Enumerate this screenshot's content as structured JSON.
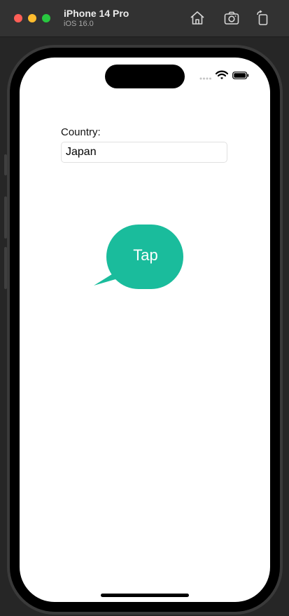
{
  "window": {
    "device_name": "iPhone 14 Pro",
    "os_version": "iOS 16.0"
  },
  "toolbar": {
    "icons": [
      "home-icon",
      "screenshot-camera-icon",
      "rotate-icon"
    ]
  },
  "app": {
    "country_label": "Country:",
    "country_value": "Japan",
    "tap_bubble_label": "Tap"
  },
  "colors": {
    "bubble": "#1abc9c",
    "traffic_red": "#fe5f57",
    "traffic_yellow": "#febc2e",
    "traffic_green": "#28c840"
  }
}
